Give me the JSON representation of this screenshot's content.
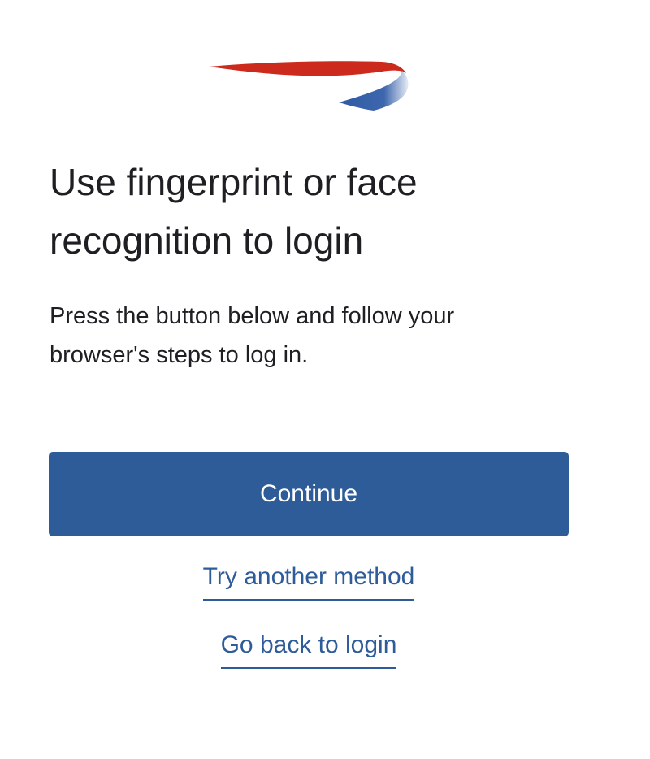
{
  "header": {
    "logo_icon": "speedmarque-logo-icon",
    "logo_colors": {
      "red": "#cc2a1d",
      "blue": "#2f5ba4"
    }
  },
  "main": {
    "title": "Use fingerprint or face recognition to login",
    "description": "Press the button below and follow your browser's steps to log in.",
    "continue_label": "Continue",
    "try_another_label": "Try another method",
    "go_back_label": "Go back to login"
  },
  "colors": {
    "primary": "#2e5c99",
    "text": "#1e1f23",
    "background": "#ffffff"
  }
}
